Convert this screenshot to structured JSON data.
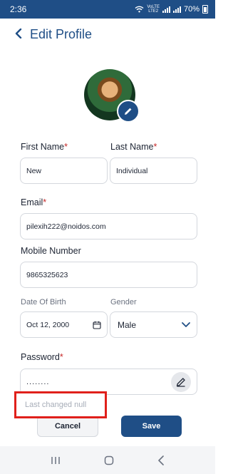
{
  "status_bar": {
    "time": "2:36",
    "network_label_top": "VoLTE",
    "network_label_bottom": "LTE2",
    "battery": "70%"
  },
  "header": {
    "title": "Edit Profile"
  },
  "form": {
    "first_name": {
      "label": "First Name",
      "required": "*",
      "value": "New"
    },
    "last_name": {
      "label": "Last Name",
      "required": "*",
      "value": "Individual"
    },
    "email": {
      "label": "Email",
      "required": "*",
      "value": "pilexih222@noidos.com"
    },
    "mobile": {
      "label": "Mobile Number",
      "value": "9865325623"
    },
    "dob": {
      "label": "Date Of Birth",
      "value": "Oct 12, 2000"
    },
    "gender": {
      "label": "Gender",
      "value": "Male"
    },
    "password": {
      "label": "Password",
      "required": "*",
      "value": "........"
    },
    "last_changed": "Last changed null"
  },
  "actions": {
    "cancel_label": "Cancel",
    "save_label": "Save"
  },
  "colors": {
    "brand": "#1f4e86",
    "required": "#c62828",
    "highlight": "#e0201b"
  },
  "icons": {
    "back": "chevron-left-icon",
    "edit_avatar": "pencil-icon",
    "calendar": "calendar-icon",
    "dropdown": "chevron-down-icon",
    "edit_password": "pen-icon"
  }
}
